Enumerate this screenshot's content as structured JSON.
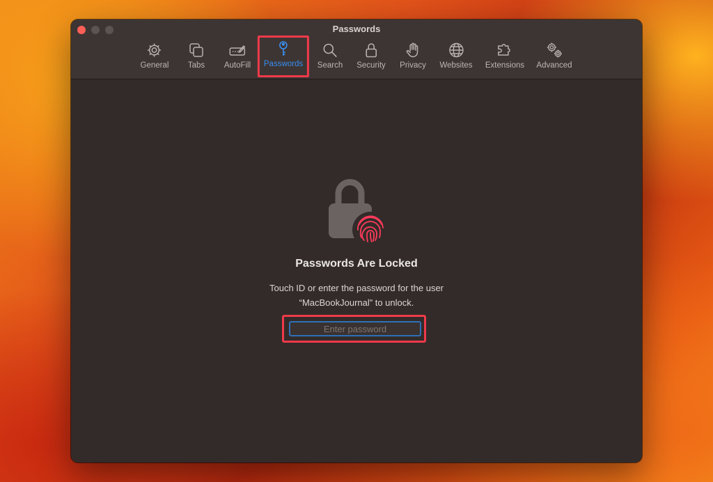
{
  "window": {
    "title": "Passwords"
  },
  "toolbar": {
    "tabs": [
      {
        "label": "General",
        "icon": "gear-icon"
      },
      {
        "label": "Tabs",
        "icon": "tabs-icon"
      },
      {
        "label": "AutoFill",
        "icon": "autofill-icon"
      },
      {
        "label": "Passwords",
        "icon": "key-icon",
        "active": true
      },
      {
        "label": "Search",
        "icon": "search-icon"
      },
      {
        "label": "Security",
        "icon": "lock-icon"
      },
      {
        "label": "Privacy",
        "icon": "hand-icon"
      },
      {
        "label": "Websites",
        "icon": "globe-icon"
      },
      {
        "label": "Extensions",
        "icon": "puzzle-icon"
      },
      {
        "label": "Advanced",
        "icon": "gears-icon"
      }
    ]
  },
  "locked": {
    "heading": "Passwords Are Locked",
    "message_line1": "Touch ID or enter the password for the user",
    "message_line2": "“MacBookJournal” to unlock.",
    "password_placeholder": "Enter password",
    "password_value": ""
  },
  "colors": {
    "accent": "#3a8ef0",
    "highlight": "#ef3a4a",
    "fingerprint": "#ff3b5c",
    "window_bg": "#332b29"
  }
}
